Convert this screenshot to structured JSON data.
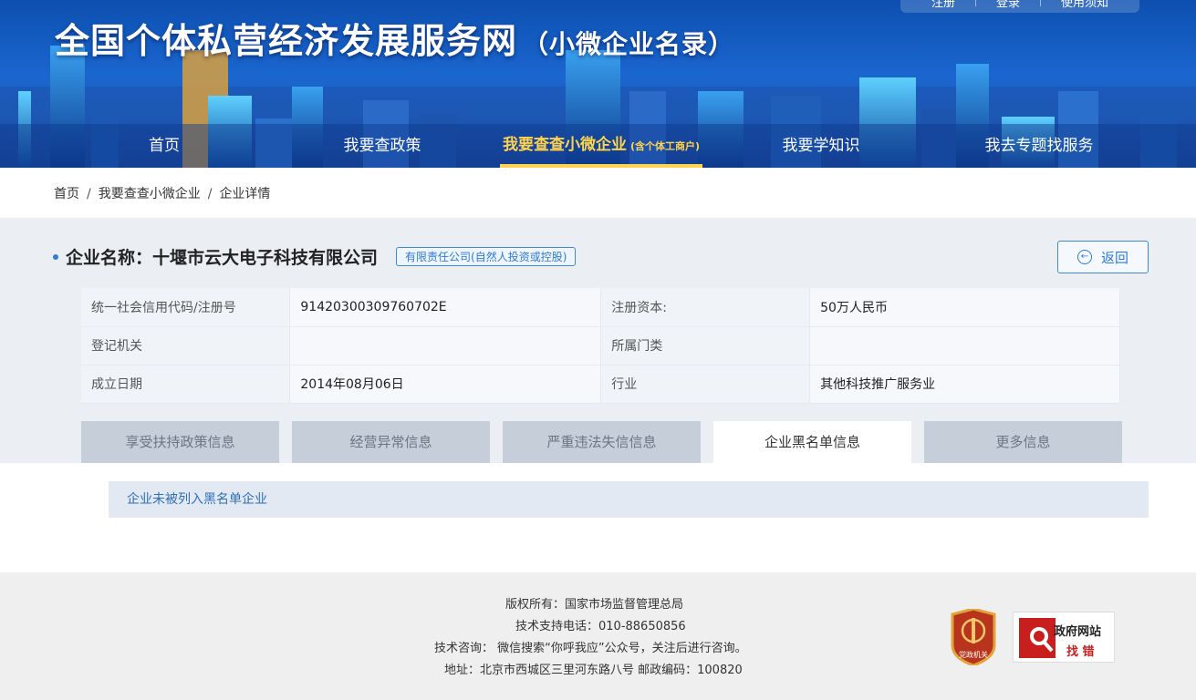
{
  "colors": {
    "primary": "#2f7bd6",
    "nav_active": "#ffd34d",
    "header_bg": "#1a66cf",
    "danger": "#c81e1e"
  },
  "header": {
    "top_links": [
      "注册",
      "登录",
      "使用须知"
    ],
    "title": "全国个体私营经济发展服务网",
    "subtitle": "（小微企业名录）"
  },
  "nav": {
    "items": [
      {
        "label": "首页"
      },
      {
        "label": "我要查政策"
      },
      {
        "label": "我要查查小微企业",
        "note": "(含个体工商户)"
      },
      {
        "label": "我要学知识"
      },
      {
        "label": "我去专题找服务"
      }
    ]
  },
  "breadcrumb": [
    "首页",
    "我要查查小微企业",
    "企业详情"
  ],
  "company": {
    "label": "企业名称：",
    "name": "十堰市云大电子科技有限公司",
    "type_tag": "有限责任公司(自然人投资或控股)",
    "back_label": "返回",
    "back_icon": "back-arrow-icon"
  },
  "info_table": {
    "rows": [
      {
        "k1": "统一社会信用代码/注册号",
        "v1": "91420300309760702E",
        "k2": "注册资本:",
        "v2": "50万人民币"
      },
      {
        "k1": "登记机关",
        "v1": "",
        "k2": "所属门类",
        "v2": ""
      },
      {
        "k1": "成立日期",
        "v1": "2014年08月06日",
        "k2": "行业",
        "v2": "其他科技推广服务业"
      }
    ]
  },
  "tabs": [
    {
      "label": "享受扶持政策信息"
    },
    {
      "label": "经营异常信息"
    },
    {
      "label": "严重违法失信信息"
    },
    {
      "label": "企业黑名单信息"
    },
    {
      "label": "更多信息"
    }
  ],
  "active_tab": "企业黑名单信息",
  "notice": "企业未被列入黑名单企业",
  "footer": {
    "lines": [
      "版权所有：国家市场监督管理总局",
      "技术支持电话：010-88650856",
      "技术咨询：  微信搜索“你呼我应”公众号，关注后进行咨询。",
      "地址：北京市西城区三里河东路八号 邮政编码：100820"
    ],
    "badge_party": "党政机关",
    "badge_gov_1": "政府网站",
    "badge_gov_2": "找 错"
  }
}
